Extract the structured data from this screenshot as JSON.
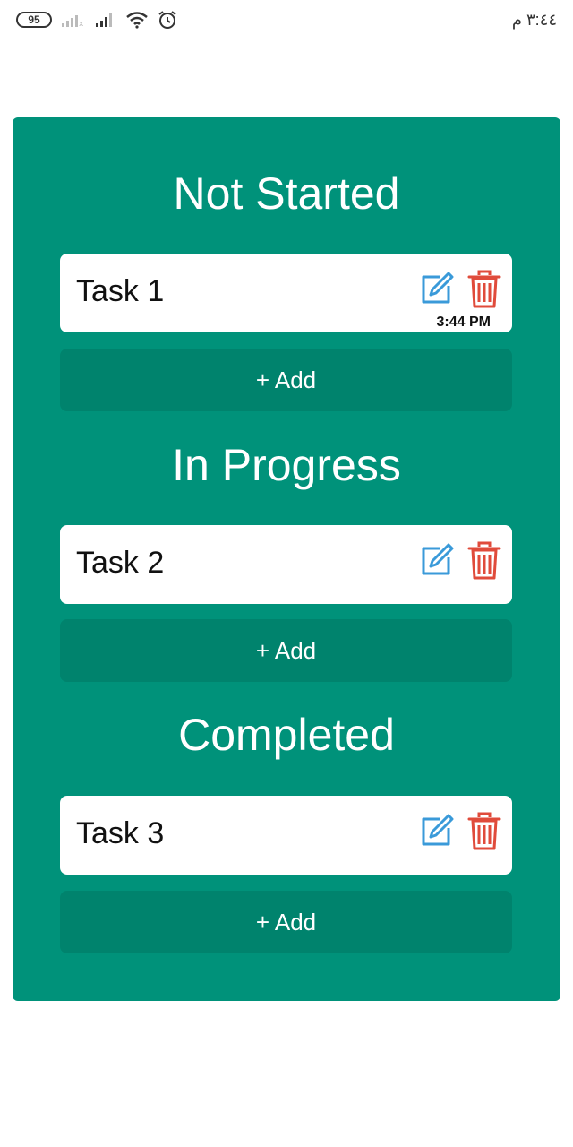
{
  "status_bar": {
    "battery": "95",
    "time": "٣:٤٤ م"
  },
  "colors": {
    "board": "#00927a",
    "add_button": "#00836d",
    "edit_icon": "#3a9ad9",
    "delete_icon": "#e04b3b"
  },
  "sections": [
    {
      "title": "Not Started",
      "task": {
        "title": "Task 1",
        "time": "3:44 PM"
      },
      "add_label": "+ Add"
    },
    {
      "title": "In Progress",
      "task": {
        "title": "Task 2"
      },
      "add_label": "+ Add"
    },
    {
      "title": "Completed",
      "task": {
        "title": "Task 3"
      },
      "add_label": "+ Add"
    }
  ]
}
